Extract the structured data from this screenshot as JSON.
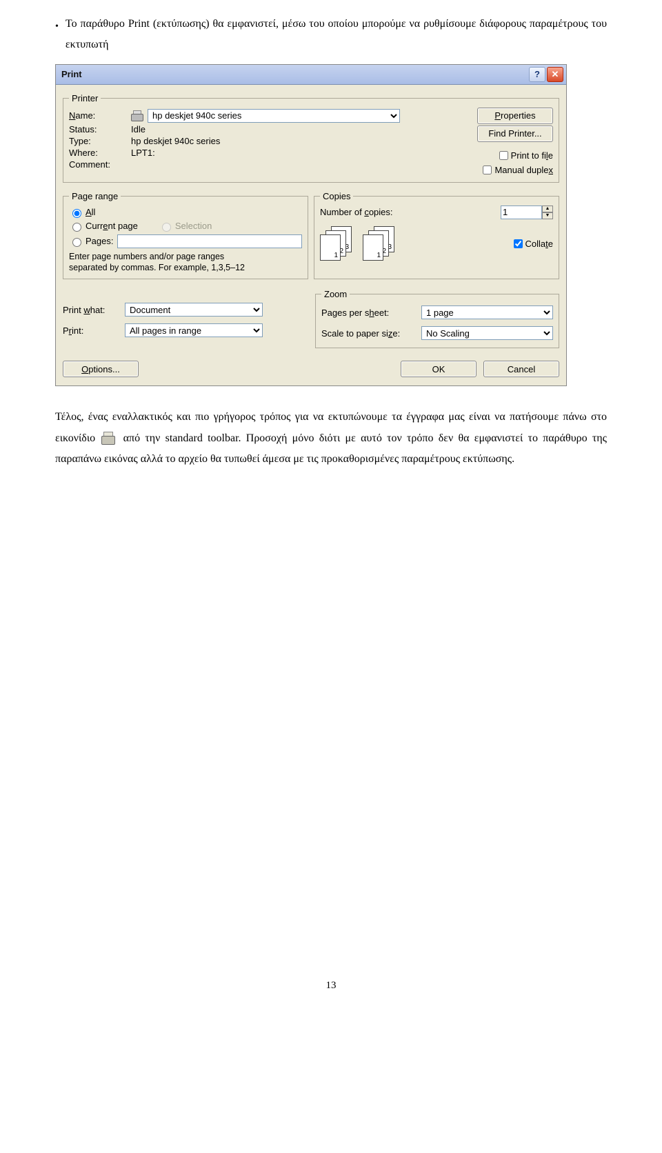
{
  "intro_bullet": "•",
  "intro_text": "Το παράθυρο Print (εκτύπωσης) θα εμφανιστεί, μέσω του οποίου μπορούμε να ρυθμίσουμε διάφορους παραμέτρους του εκτυπωτή",
  "dialog": {
    "title": "Print",
    "printer": {
      "legend": "Printer",
      "name_label": "Name:",
      "name_value": "hp deskjet 940c series",
      "status_label": "Status:",
      "status_value": "Idle",
      "type_label": "Type:",
      "type_value": "hp deskjet 940c series",
      "where_label": "Where:",
      "where_value": "LPT1:",
      "comment_label": "Comment:",
      "comment_value": "",
      "properties_btn": "Properties",
      "find_btn": "Find Printer...",
      "print_to_file": "Print to file",
      "manual_duplex": "Manual duplex"
    },
    "page_range": {
      "legend": "Page range",
      "all": "All",
      "current": "Current page",
      "selection": "Selection",
      "pages_label": "Pages:",
      "pages_value": "",
      "hint1": "Enter page numbers and/or page ranges",
      "hint2": "separated by commas. For example, 1,3,5–12"
    },
    "copies": {
      "legend": "Copies",
      "num_label": "Number of copies:",
      "num_value": "1",
      "collate": "Collate",
      "sheet1": "1",
      "sheet2": "2",
      "sheet3": "3"
    },
    "print_what": {
      "label": "Print what:",
      "value": "Document"
    },
    "print": {
      "label": "Print:",
      "value": "All pages in range"
    },
    "zoom": {
      "legend": "Zoom",
      "pps_label": "Pages per sheet:",
      "pps_value": "1 page",
      "scale_label": "Scale to paper size:",
      "scale_value": "No Scaling"
    },
    "options_btn": "Options...",
    "ok_btn": "OK",
    "cancel_btn": "Cancel"
  },
  "para2_a": "Τέλος, ένας εναλλακτικός και πιο γρήγορος τρόπος για να εκτυπώνουμε τα έγγραφα μας είναι να πατήσουμε πάνω στο εικονίδιο ",
  "para2_b": " από την standard toolbar. Προσοχή μόνο διότι με αυτό τον τρόπο δεν θα εμφανιστεί το παράθυρο της παραπάνω εικόνας αλλά το αρχείο θα τυπωθεί άμεσα με τις προκαθορισμένες παραμέτρους εκτύπωσης.",
  "page_number": "13"
}
